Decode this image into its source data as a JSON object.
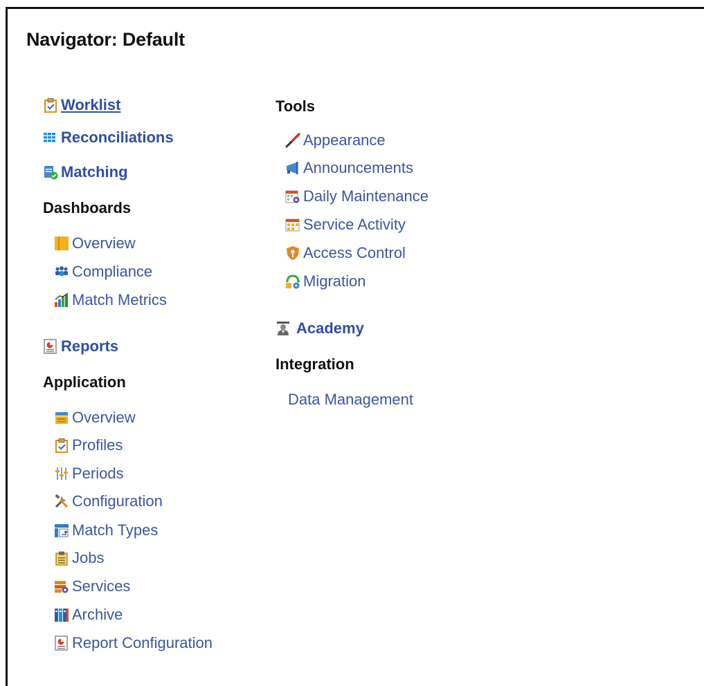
{
  "page": {
    "title": "Navigator: Default"
  },
  "nav": {
    "worklist": "Worklist",
    "reconciliations": "Reconciliations",
    "matching": "Matching",
    "dashboards": {
      "heading": "Dashboards",
      "items": [
        "Overview",
        "Compliance",
        "Match Metrics"
      ]
    },
    "reports": "Reports",
    "application": {
      "heading": "Application",
      "items": [
        "Overview",
        "Profiles",
        "Periods",
        "Configuration",
        "Match Types",
        "Jobs",
        "Services",
        "Archive",
        "Report Configuration"
      ]
    },
    "tools": {
      "heading": "Tools",
      "items": [
        "Appearance",
        "Announcements",
        "Daily Maintenance",
        "Service Activity",
        "Access Control",
        "Migration"
      ]
    },
    "academy": "Academy",
    "integration": {
      "heading": "Integration",
      "items": [
        "Data Management"
      ]
    }
  },
  "icons": {
    "worklist": "clipboard-check-icon",
    "reconciliations": "grid-icon",
    "matching": "document-check-icon",
    "overview": "panel-icon",
    "compliance": "people-icon",
    "match_metrics": "bar-chart-icon",
    "reports": "report-icon",
    "app_overview": "inbox-icon",
    "profiles": "clipboard-check-icon",
    "periods": "sliders-icon",
    "configuration": "tools-icon",
    "match_types": "matrix-icon",
    "jobs": "clipboard-icon",
    "services": "server-gear-icon",
    "archive": "binders-icon",
    "report_configuration": "report-icon",
    "appearance": "brush-icon",
    "announcements": "megaphone-icon",
    "daily_maintenance": "calendar-gear-icon",
    "service_activity": "calendar-grid-icon",
    "access_control": "shield-key-icon",
    "migration": "migration-icon",
    "academy": "graduation-icon"
  },
  "colors": {
    "link": "#2f4f9f",
    "text": "#111111",
    "border": "#111111"
  }
}
